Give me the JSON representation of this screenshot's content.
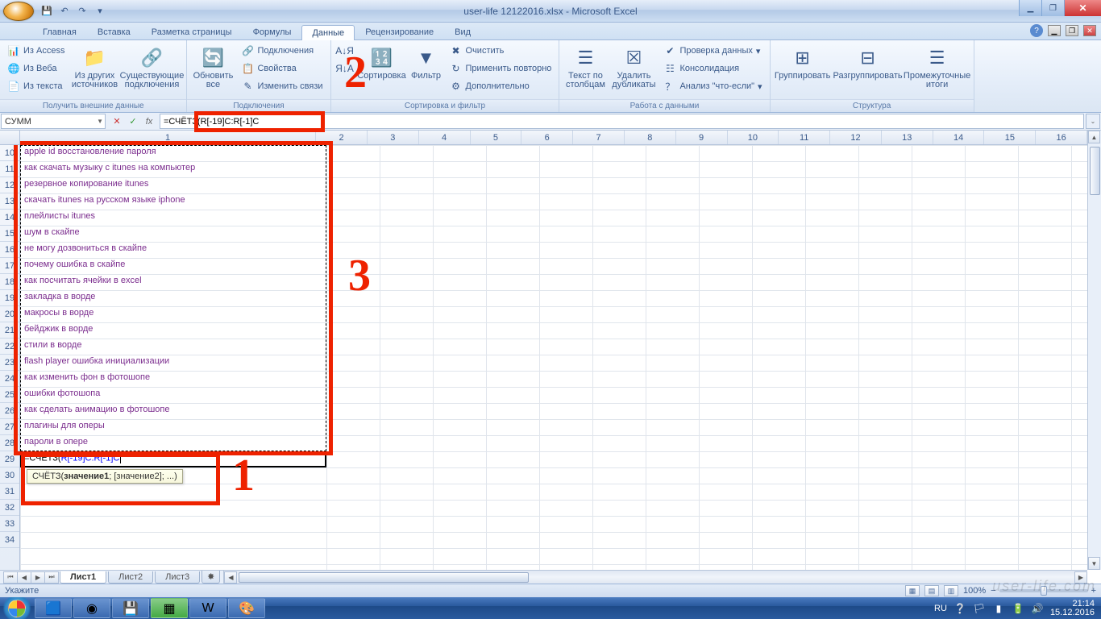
{
  "title": "user-life 12122016.xlsx - Microsoft Excel",
  "qat": {
    "save": "💾",
    "undo": "↶",
    "redo": "↷",
    "more": "▾"
  },
  "tabs": {
    "items": [
      "Главная",
      "Вставка",
      "Разметка страницы",
      "Формулы",
      "Данные",
      "Рецензирование",
      "Вид"
    ],
    "active_index": 4
  },
  "ribbon": {
    "groups": [
      {
        "label": "Получить внешние данные",
        "items_sm": [
          "Из Access",
          "Из Веба",
          "Из текста"
        ],
        "items_lg": [
          "Из других источников",
          "Существующие подключения"
        ]
      },
      {
        "label": "Подключения",
        "items_lg": [
          "Обновить все"
        ],
        "items_sm": [
          "Подключения",
          "Свойства",
          "Изменить связи"
        ]
      },
      {
        "label": "Сортировка и фильтр",
        "items_lg": [
          "",
          "Сортировка",
          "Фильтр"
        ],
        "sort_small": [
          "А↓Я",
          "Я↓А"
        ],
        "items_sm": [
          "Очистить",
          "Применить повторно",
          "Дополнительно"
        ]
      },
      {
        "label": "Работа с данными",
        "items_lg": [
          "Текст по столбцам",
          "Удалить дубликаты"
        ],
        "items_sm": [
          "Проверка данных",
          "Консолидация",
          "Анализ \"что-если\""
        ]
      },
      {
        "label": "Структура",
        "items_lg": [
          "Группировать",
          "Разгруппировать",
          "Промежуточные итоги"
        ]
      }
    ]
  },
  "namebox": "СУММ",
  "formula": "=СЧЁТЗ(R[-19]C:R[-1]C",
  "formula_colored_part": "R[-19]C:R[-1]C",
  "tooltip": "СЧЁТЗ(значение1; [значение2]; ...)",
  "tooltip_bold": "значение1",
  "cells": {
    "col1_width": 380,
    "first_row": 10,
    "rows": [
      "apple id восстановление пароля",
      "как скачать музыку с itunes на компьютер",
      "резервное копирование itunes",
      "скачать itunes на русском языке iphone",
      "плейлисты itunes",
      "шум в скайпе",
      "не могу дозвониться в скайпе",
      "почему ошибка в скайпе",
      "как посчитать ячейки в excel",
      "закладка в ворде",
      "макросы в ворде",
      "бейджик в ворде",
      "стили в ворде",
      "flash player ошибка инициализации",
      "как изменить фон в фотошопе",
      "ошибки фотошопа",
      "как сделать анимацию в фотошопе",
      "плагины для  оперы",
      "пароли в опере"
    ],
    "formula_cell": "=СЧЁТЗ(R[-19]C:R[-1]C"
  },
  "col_headers": [
    "1",
    "2",
    "3",
    "4",
    "5",
    "6",
    "7",
    "8",
    "9",
    "10",
    "11",
    "12",
    "13",
    "14",
    "15",
    "16"
  ],
  "row_start": 10,
  "row_end": 34,
  "sheets": {
    "tabs": [
      "Лист1",
      "Лист2",
      "Лист3"
    ],
    "active": 0
  },
  "status": {
    "left": "Укажите",
    "zoom": "100%"
  },
  "tray": {
    "lang": "RU",
    "time": "21:14",
    "date": "15.12.2016"
  },
  "annotations": {
    "1": "1",
    "2": "2",
    "3": "3"
  },
  "watermark": "user-life.com"
}
